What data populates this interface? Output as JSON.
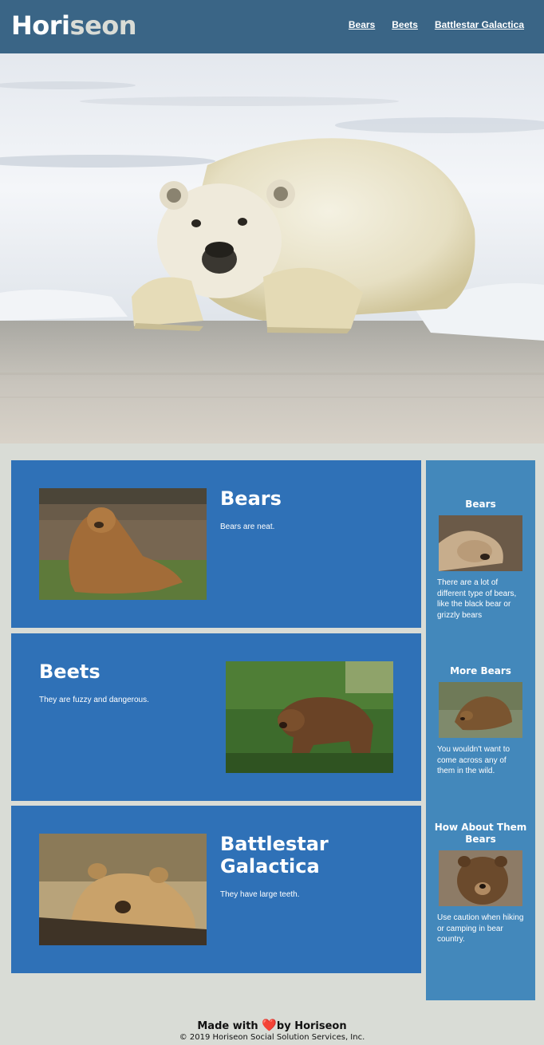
{
  "header": {
    "logo_main": "Hori",
    "logo_accent": "seon",
    "nav": [
      {
        "label": "Bears"
      },
      {
        "label": "Beets"
      },
      {
        "label": "Battlestar Galactica"
      }
    ]
  },
  "main": {
    "cards": [
      {
        "title": "Bears",
        "text": "Bears are neat."
      },
      {
        "title": "Beets",
        "text": "They are fuzzy and dangerous."
      },
      {
        "title": "Battlestar Galactica",
        "text": "They have large teeth."
      }
    ]
  },
  "sidebar": {
    "items": [
      {
        "title": "Bears",
        "text": "There are a lot of different type of bears, like the black bear or grizzly bears"
      },
      {
        "title": "More Bears",
        "text": "You wouldn't want to come across any of them in the wild."
      },
      {
        "title": "How About Them Bears",
        "text": "Use caution when hiking or camping in bear country."
      }
    ]
  },
  "footer": {
    "made_prefix": "Made with",
    "made_suffix": "by Horiseon",
    "heart": "❤️",
    "copyright": "© 2019 Horiseon Social Solution Services, Inc."
  },
  "colors": {
    "header_bg": "#3a6586",
    "card_bg": "#2f71b7",
    "sidebar_bg": "#4388bb",
    "page_bg": "#d9dcd6"
  }
}
